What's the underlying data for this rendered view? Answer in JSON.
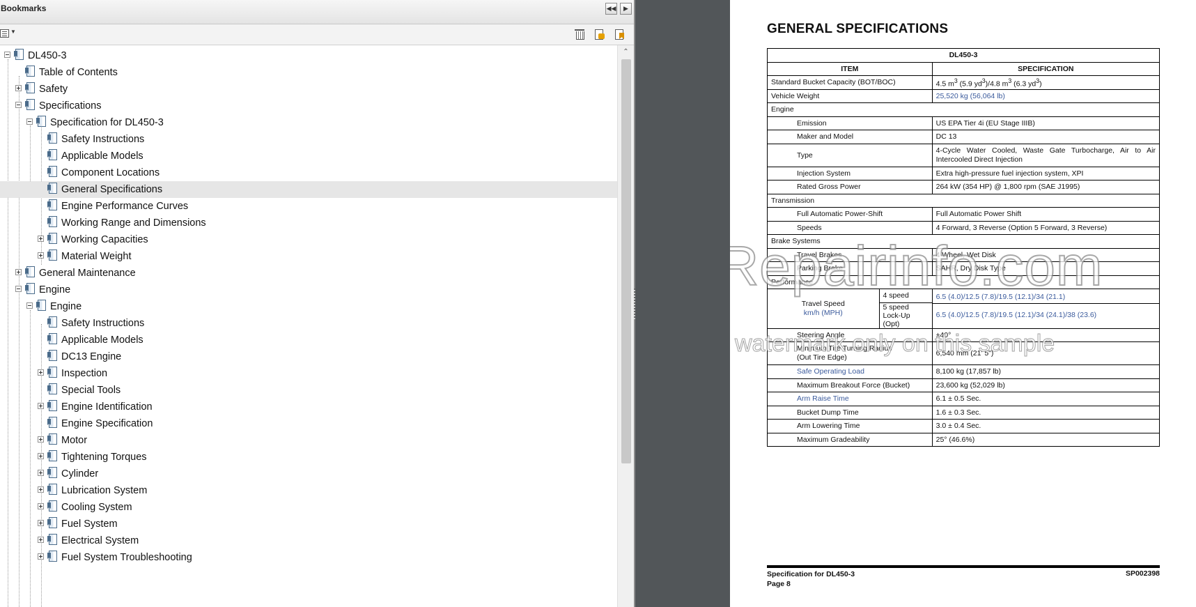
{
  "bookmarks": {
    "title": "Bookmarks",
    "items": [
      {
        "label": "DL450-3",
        "toggle": "expanded"
      },
      {
        "label": "Table of Contents",
        "toggle": "none"
      },
      {
        "label": "Safety",
        "toggle": "collapsed"
      },
      {
        "label": "Specifications",
        "toggle": "expanded"
      },
      {
        "label": "Specification for DL450-3",
        "toggle": "expanded"
      },
      {
        "label": "Safety Instructions",
        "toggle": "none"
      },
      {
        "label": "Applicable Models",
        "toggle": "none"
      },
      {
        "label": "Component Locations",
        "toggle": "none"
      },
      {
        "label": "General Specifications",
        "toggle": "none",
        "selected": true
      },
      {
        "label": "Engine Performance Curves",
        "toggle": "none"
      },
      {
        "label": "Working Range and Dimensions",
        "toggle": "none"
      },
      {
        "label": "Working Capacities",
        "toggle": "collapsed"
      },
      {
        "label": "Material Weight",
        "toggle": "collapsed"
      },
      {
        "label": "General Maintenance",
        "toggle": "collapsed"
      },
      {
        "label": "Engine",
        "toggle": "expanded"
      },
      {
        "label": "Engine",
        "toggle": "expanded"
      },
      {
        "label": "Safety Instructions",
        "toggle": "none"
      },
      {
        "label": "Applicable Models",
        "toggle": "none"
      },
      {
        "label": "DC13 Engine",
        "toggle": "none"
      },
      {
        "label": "Inspection",
        "toggle": "collapsed"
      },
      {
        "label": "Special Tools",
        "toggle": "none"
      },
      {
        "label": "Engine Identification",
        "toggle": "collapsed"
      },
      {
        "label": "Engine Specification",
        "toggle": "none"
      },
      {
        "label": "Motor",
        "toggle": "collapsed"
      },
      {
        "label": "Tightening Torques",
        "toggle": "collapsed"
      },
      {
        "label": "Cylinder",
        "toggle": "collapsed"
      },
      {
        "label": "Lubrication System",
        "toggle": "collapsed"
      },
      {
        "label": "Cooling System",
        "toggle": "collapsed"
      },
      {
        "label": "Fuel System",
        "toggle": "collapsed"
      },
      {
        "label": "Electrical System",
        "toggle": "collapsed"
      },
      {
        "label": "Fuel System Troubleshooting",
        "toggle": "collapsed"
      }
    ]
  },
  "document": {
    "title": "GENERAL SPECIFICATIONS",
    "model": "DL450-3",
    "col_item": "ITEM",
    "col_spec": "SPECIFICATION",
    "rows": {
      "bucket_item": "Standard Bucket Capacity (BOT/BOC)",
      "bucket_spec_a": "4.5 m",
      "bucket_spec_b": " (5.9 yd",
      "bucket_spec_c": ")/4.8 m",
      "bucket_spec_d": " (6.3 yd",
      "bucket_spec_e": ")",
      "sup3": "3",
      "weight_item": "Vehicle Weight",
      "weight_spec": "25,520 kg (56,064 lb)",
      "engine_section": "Engine",
      "emission_item": "Emission",
      "emission_spec": "US EPA Tier 4i (EU Stage IIIB)",
      "maker_item": "Maker and Model",
      "maker_spec": "DC 13",
      "type_item": "Type",
      "type_spec": "4-Cycle Water Cooled, Waste Gate Turbocharge, Air to Air Intercooled Direct Injection",
      "injection_item": "Injection System",
      "injection_spec": "Extra high-pressure fuel injection system, XPI",
      "power_item": "Rated Gross Power",
      "power_spec": "264 kW (354 HP) @ 1,800 rpm (SAE J1995)",
      "transmission_section": "Transmission",
      "powershift_item": "Full Automatic Power-Shift",
      "powershift_spec": "Full Automatic Power Shift",
      "speeds_item": "Speeds",
      "speeds_spec": "4 Forward, 3 Reverse (Option 5 Forward, 3 Reverse)",
      "brake_section": "Brake Systems",
      "travel_brakes_item": "Travel Brakes",
      "travel_brakes_spec": "4 Wheel, Wet Disk",
      "parking_brake_item": "Parking Brake",
      "parking_brake_spec": "SAHR, Dry Disk Type",
      "performance_section": "Performance",
      "travel_speed_item": "Travel Speed",
      "travel_speed_unit": "km/h (MPH)",
      "speed4_label": "4 speed",
      "speed4_spec": "6.5 (4.0)/12.5 (7.8)/19.5 (12.1)/34 (21.1)",
      "speed5_label_a": "5 speed",
      "speed5_label_b": "Lock-Up (Opt)",
      "speed5_spec": "6.5 (4.0)/12.5 (7.8)/19.5 (12.1)/34 (24.1)/38 (23.6)",
      "steering_item": "Steering Angle",
      "steering_spec": "±40°",
      "turning_item_a": "Minimum Tire Turning Radius",
      "turning_item_b": "(Out Tire Edge)",
      "turning_spec": "6,540 mm (21' 5\")",
      "sol_item": "Safe Operating Load",
      "sol_spec": "8,100 kg (17,857 lb)",
      "breakout_item": "Maximum Breakout Force (Bucket)",
      "breakout_spec": "23,600 kg (52,029 lb)",
      "arm_raise_item": "Arm Raise Time",
      "arm_raise_spec": "6.1 ± 0.5 Sec.",
      "dump_item": "Bucket Dump Time",
      "dump_spec": "1.6 ± 0.3 Sec.",
      "lowering_item": "Arm Lowering Time",
      "lowering_spec": "3.0 ± 0.4 Sec.",
      "grade_item": "Maximum Gradeability",
      "grade_spec": "25° (46.6%)"
    },
    "watermark_main": "eRepairinfo.com",
    "watermark_sub": "watermark only on this sample",
    "footer_left_a": "Specification for DL450-3",
    "footer_left_b": "Page 8",
    "footer_right": "SP002398"
  }
}
